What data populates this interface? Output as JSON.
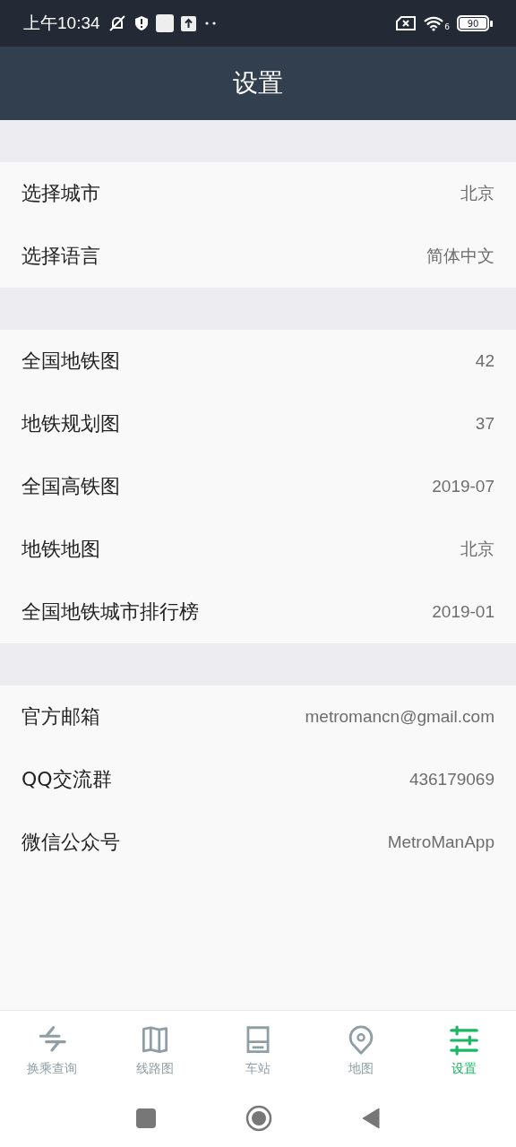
{
  "status_bar": {
    "time": "上午10:34",
    "wifi_label": "6",
    "battery": "90"
  },
  "header": {
    "title": "设置"
  },
  "sections": [
    {
      "rows": [
        {
          "label": "选择城市",
          "value": "北京"
        },
        {
          "label": "选择语言",
          "value": "简体中文"
        }
      ]
    },
    {
      "rows": [
        {
          "label": "全国地铁图",
          "value": "42"
        },
        {
          "label": "地铁规划图",
          "value": "37"
        },
        {
          "label": "全国高铁图",
          "value": "2019-07"
        },
        {
          "label": "地铁地图",
          "value": "北京"
        },
        {
          "label": "全国地铁城市排行榜",
          "value": "2019-01"
        }
      ]
    },
    {
      "rows": [
        {
          "label": "官方邮箱",
          "value": "metromancn@gmail.com"
        },
        {
          "label": "QQ交流群",
          "value": "436179069"
        },
        {
          "label": "微信公众号",
          "value": "MetroManApp"
        }
      ]
    }
  ],
  "tabs": [
    {
      "kind": "transfer",
      "label": "换乘查询",
      "selected": false
    },
    {
      "kind": "lines",
      "label": "线路图",
      "selected": false
    },
    {
      "kind": "station",
      "label": "车站",
      "selected": false
    },
    {
      "kind": "map",
      "label": "地图",
      "selected": false
    },
    {
      "kind": "settings",
      "label": "设置",
      "selected": true
    }
  ]
}
